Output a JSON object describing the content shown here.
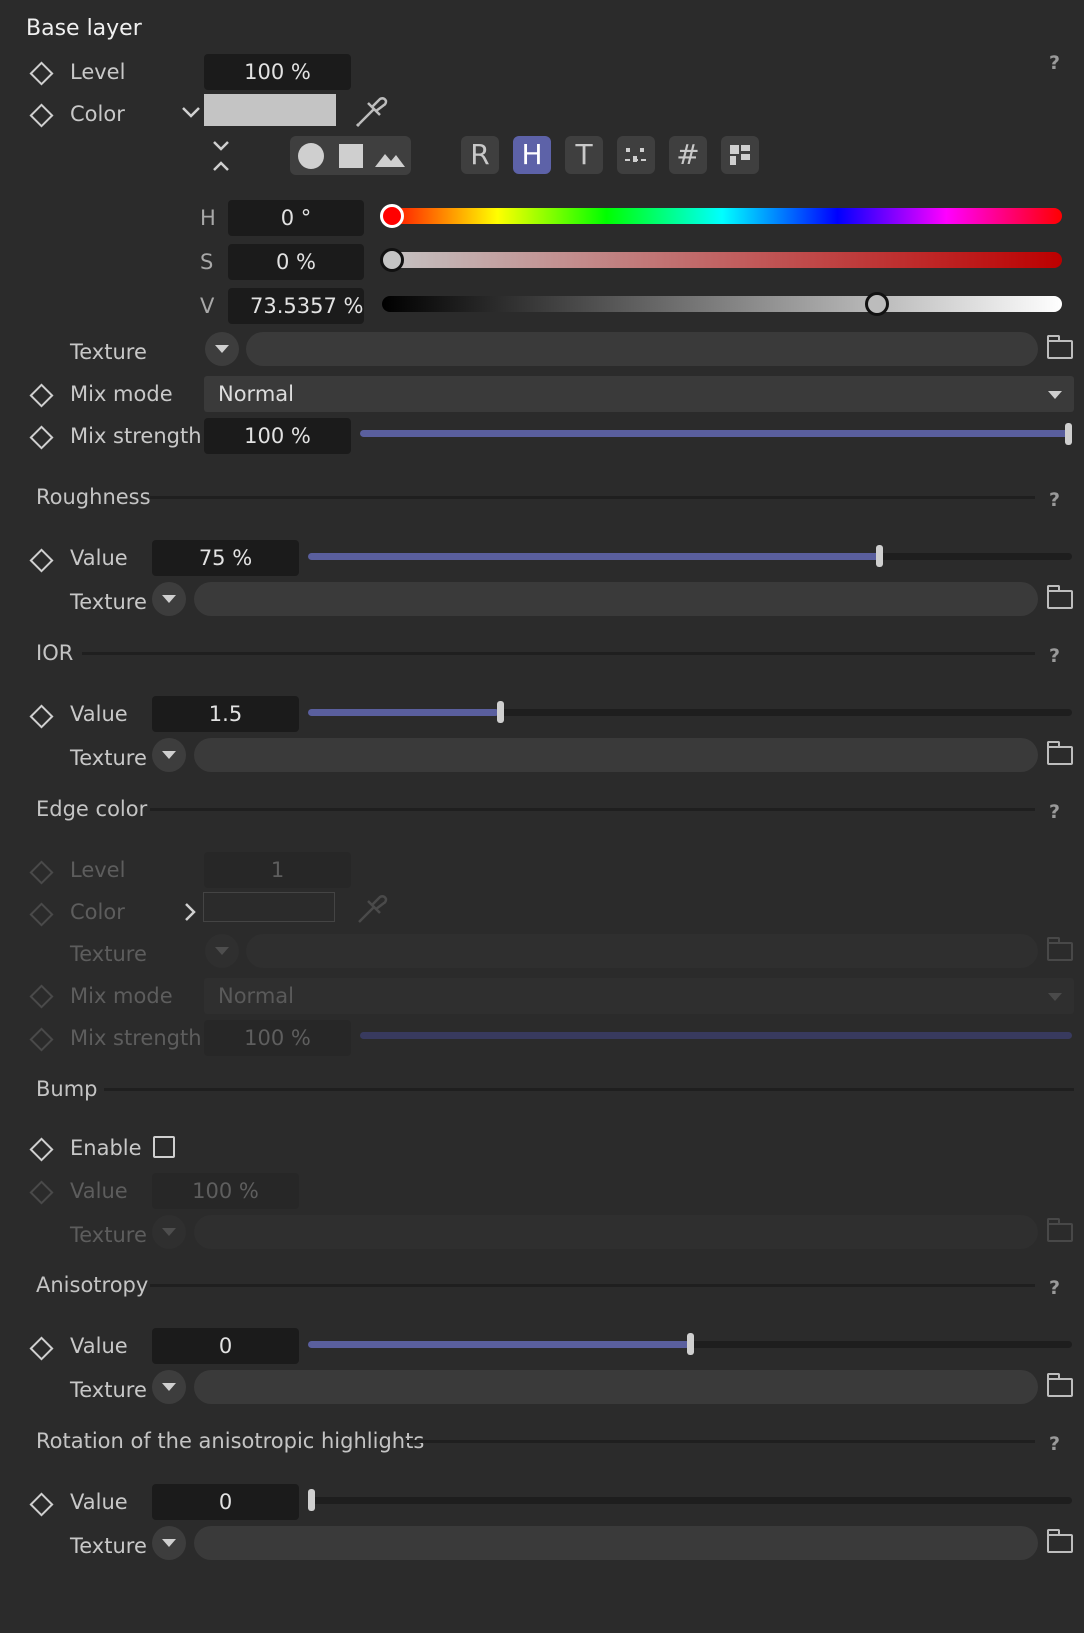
{
  "base_layer": {
    "title": "Base layer",
    "level_label": "Level",
    "level_value": "100 %",
    "color_label": "Color",
    "swatch_color": "#c4c4c4",
    "modes": [
      "R",
      "H",
      "T",
      "#"
    ],
    "active_mode": "H",
    "hsv": {
      "h_label": "H",
      "h_value": "0 °",
      "h_fraction": 0.0,
      "s_label": "S",
      "s_value": "0 %",
      "s_fraction": 0.0,
      "v_label": "V",
      "v_value": "73.5357 %",
      "v_fraction": 0.735357
    },
    "texture_label": "Texture",
    "mix_mode_label": "Mix mode",
    "mix_mode_value": "Normal",
    "mix_strength_label": "Mix strength",
    "mix_strength_value": "100 %",
    "mix_strength_fraction": 1.0,
    "help": "?"
  },
  "roughness": {
    "title": "Roughness",
    "value_label": "Value",
    "value": "75 %",
    "fraction": 0.75,
    "texture_label": "Texture",
    "help": "?"
  },
  "ior": {
    "title": "IOR",
    "value_label": "Value",
    "value": "1.5",
    "fraction": 0.25,
    "texture_label": "Texture",
    "help": "?"
  },
  "edge_color": {
    "title": "Edge color",
    "help": "?",
    "level_label": "Level",
    "level_value": "1",
    "color_label": "Color",
    "texture_label": "Texture",
    "mix_mode_label": "Mix mode",
    "mix_mode_value": "Normal",
    "mix_strength_label": "Mix strength",
    "mix_strength_value": "100 %"
  },
  "bump": {
    "title": "Bump",
    "enable_label": "Enable",
    "enabled": false,
    "value_label": "Value",
    "value": "100 %",
    "texture_label": "Texture"
  },
  "anisotropy": {
    "title": "Anisotropy",
    "value_label": "Value",
    "value": "0",
    "fraction": 0.5,
    "texture_label": "Texture",
    "help": "?"
  },
  "rotation": {
    "title": "Rotation of the anisotropic highlights",
    "value_label": "Value",
    "value": "0",
    "fraction": 0.0,
    "texture_label": "Texture",
    "help": "?"
  },
  "colors": {
    "accent": "#5d62a8",
    "background": "#2b2b2b"
  }
}
